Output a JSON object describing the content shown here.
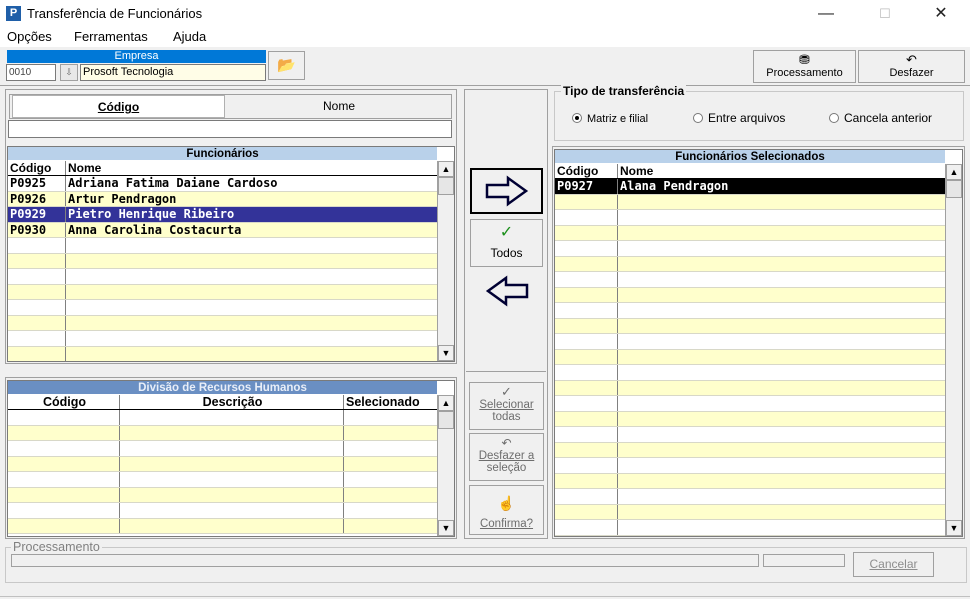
{
  "window": {
    "title": "Transferência de Funcionários",
    "icon_letter": "P",
    "minimize_glyph": "—",
    "maximize_glyph": "☐",
    "close_glyph": "✕"
  },
  "menu": [
    "Opções",
    "Ferramentas",
    "Ajuda"
  ],
  "empresa": {
    "header": "Empresa",
    "code": "0010",
    "name": "Prosoft Tecnologia"
  },
  "toolbar": {
    "processamento_label": "Processamento",
    "desfazer_label": "Desfazer"
  },
  "search": {
    "tab_codigo": "Código",
    "tab_nome": "Nome",
    "value": ""
  },
  "funcionarios": {
    "title": "Funcionários",
    "col_codigo": "Código",
    "col_nome": "Nome",
    "rows": [
      {
        "codigo": "P0925",
        "nome": "Adriana Fatima Daiane Cardoso"
      },
      {
        "codigo": "P0926",
        "nome": "Artur Pendragon"
      },
      {
        "codigo": "P0929",
        "nome": "Pietro Henrique Ribeiro"
      },
      {
        "codigo": "P0930",
        "nome": "Anna Carolina Costacurta"
      }
    ]
  },
  "divisao": {
    "title": "Divisão de Recursos Humanos",
    "col_codigo": "Código",
    "col_descricao": "Descrição",
    "col_selecionado": "Selecionado"
  },
  "actions": {
    "todos": "Todos",
    "selecionar_todas_1": "Selecionar",
    "selecionar_todas_2": "todas",
    "desfazer_selecao_1": "Desfazer a",
    "desfazer_selecao_2": "seleção",
    "confirma": "Confirma?"
  },
  "tipo": {
    "label": "Tipo de transferência",
    "options": [
      "Matriz e filial",
      "Entre arquivos",
      "Cancela anterior"
    ],
    "selected": "Matriz e filial"
  },
  "selecionados": {
    "title": "Funcionários Selecionados",
    "col_codigo": "Código",
    "col_nome": "Nome",
    "rows": [
      {
        "codigo": "P0927",
        "nome": "Alana Pendragon"
      }
    ]
  },
  "processamento": {
    "label": "Processamento",
    "cancelar": "Cancelar"
  },
  "colors": {
    "row_yellow": "#ffffcc",
    "row_selected": "#333399",
    "header_blue": "#b9d1ea",
    "accent": "#0078d7"
  }
}
